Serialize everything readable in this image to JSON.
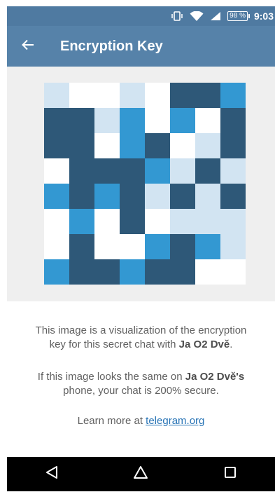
{
  "status_bar": {
    "battery": "98 %",
    "time": "9:03"
  },
  "app_bar": {
    "title": "Encryption Key"
  },
  "key": {
    "colors": [
      "#d2e4f2",
      "#ffffff",
      "#3398d2",
      "#2e5878"
    ],
    "grid": [
      [
        0,
        1,
        1,
        0,
        1,
        3,
        3,
        2
      ],
      [
        3,
        3,
        0,
        2,
        1,
        2,
        1,
        3
      ],
      [
        3,
        3,
        1,
        2,
        3,
        1,
        0,
        3
      ],
      [
        1,
        3,
        3,
        3,
        2,
        0,
        3,
        0
      ],
      [
        2,
        3,
        2,
        3,
        0,
        3,
        0,
        3
      ],
      [
        1,
        2,
        1,
        3,
        1,
        0,
        0,
        0
      ],
      [
        1,
        3,
        1,
        1,
        2,
        3,
        2,
        0
      ],
      [
        2,
        3,
        3,
        2,
        3,
        3,
        1,
        1
      ]
    ]
  },
  "info": {
    "line1_prefix": "This image is a visualization of the encryption",
    "line1_suffix": "key for this secret chat with ",
    "chat_name": "Ja O2 Dvě",
    "line1_end": ".",
    "line2_prefix": "If this image looks the same on ",
    "chat_name_possessive": "Ja O2 Dvě's",
    "line2_suffix": "phone, your chat is 200% secure.",
    "learn_more": "Learn more at ",
    "link_text": "telegram.org"
  },
  "icons": {
    "back": "arrow-left-icon",
    "nav_back": "triangle-back-icon",
    "nav_home": "circle-home-icon",
    "nav_recents": "square-recents-icon"
  }
}
